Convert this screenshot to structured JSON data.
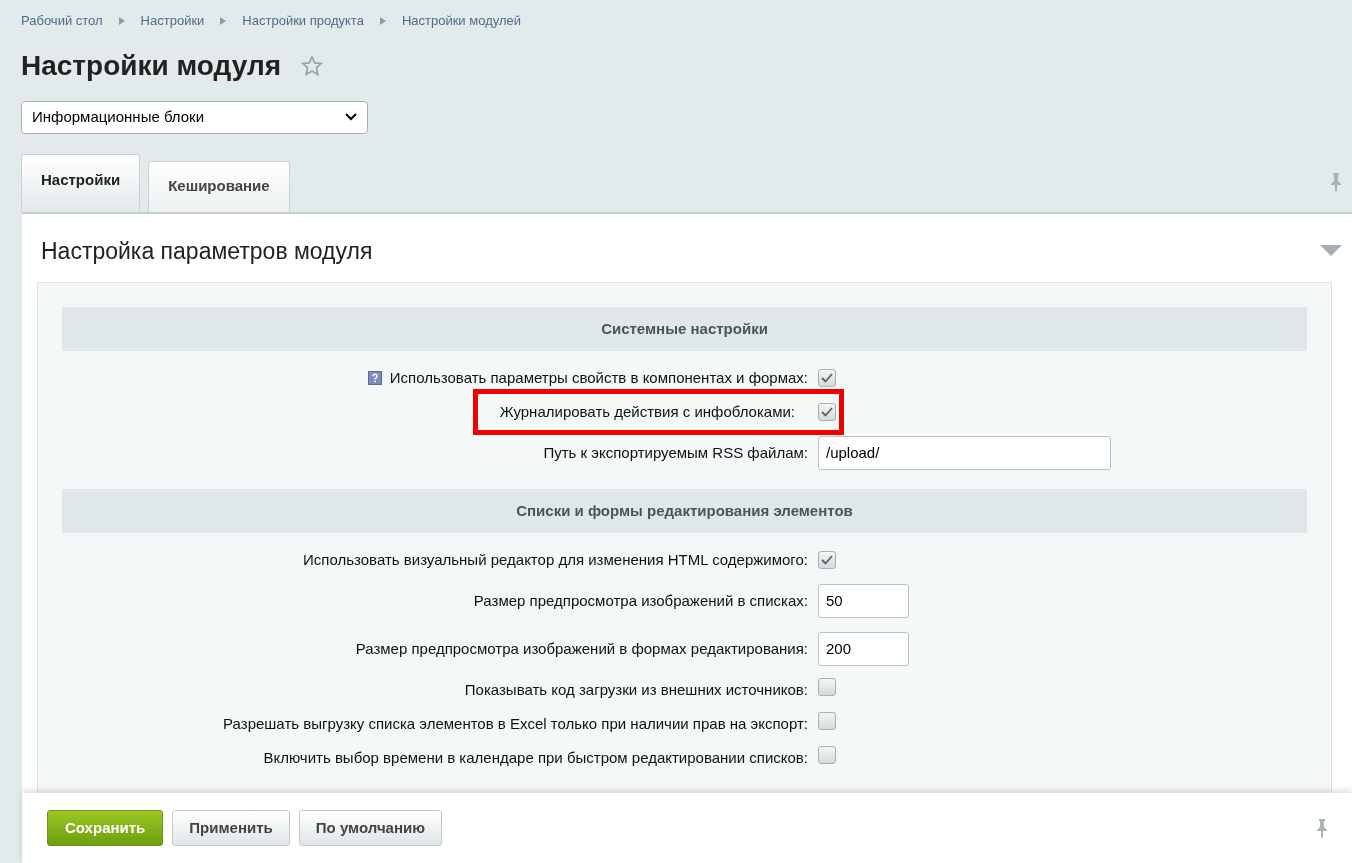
{
  "breadcrumbs": [
    "Рабочий стол",
    "Настройки",
    "Настройки продукта",
    "Настройки модулей"
  ],
  "title": "Настройки модуля",
  "module_select": {
    "value": "Информационные блоки"
  },
  "tabs": [
    {
      "label": "Настройки",
      "selected": true
    },
    {
      "label": "Кеширование",
      "selected": false
    }
  ],
  "panel": {
    "title": "Настройка параметров модуля",
    "sections": [
      {
        "title": "Системные настройки",
        "rows": [
          {
            "kind": "checkbox",
            "label": "Использовать параметры свойств в компонентах и формах:",
            "checked": true,
            "help": true,
            "highlighted": false
          },
          {
            "kind": "checkbox",
            "label": "Журналировать действия с инфоблоками:",
            "checked": true,
            "help": false,
            "highlighted": true
          },
          {
            "kind": "text",
            "label": "Путь к экспортируемым RSS файлам:",
            "value": "/upload/",
            "help": false,
            "highlighted": false
          }
        ]
      },
      {
        "title": "Списки и формы редактирования элементов",
        "rows": [
          {
            "kind": "checkbox",
            "label": "Использовать визуальный редактор для изменения HTML содержимого:",
            "checked": true,
            "help": false,
            "highlighted": false
          },
          {
            "kind": "number",
            "label": "Размер предпросмотра изображений в списках:",
            "value": "50",
            "help": false,
            "highlighted": false
          },
          {
            "kind": "number",
            "label": "Размер предпросмотра изображений в формах редактирования:",
            "value": "200",
            "help": false,
            "highlighted": false
          },
          {
            "kind": "checkbox",
            "label": "Показывать код загрузки из внешних источников:",
            "checked": false,
            "help": false,
            "highlighted": false
          },
          {
            "kind": "checkbox",
            "label": "Разрешать выгрузку списка элементов в Excel только при наличии прав на экспорт:",
            "checked": false,
            "help": false,
            "highlighted": false
          },
          {
            "kind": "checkbox",
            "label": "Включить выбор времени в календаре при быстром редактировании списков:",
            "checked": false,
            "help": false,
            "highlighted": false
          }
        ]
      }
    ]
  },
  "buttons": [
    {
      "label": "Сохранить",
      "kind": "primary"
    },
    {
      "label": "Применить",
      "kind": "secondary"
    },
    {
      "label": "По умолчанию",
      "kind": "secondary"
    }
  ]
}
